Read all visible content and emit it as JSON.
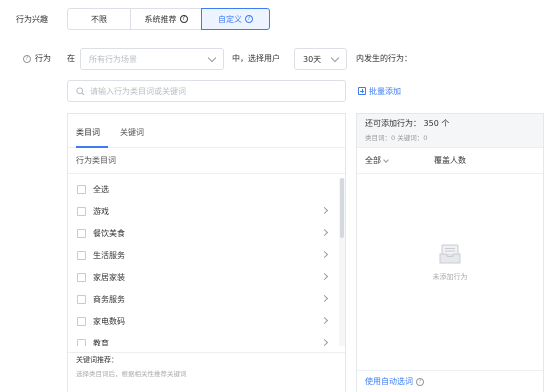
{
  "interest": {
    "label": "行为兴趣",
    "options": [
      "不限",
      "系统推荐",
      "自定义"
    ],
    "selected": "自定义"
  },
  "behavior": {
    "label": "行为",
    "prefix": "在",
    "scene_placeholder": "所有行为场景",
    "middle": "中，选择用户",
    "days_value": "30天",
    "suffix": "内发生的行为："
  },
  "search": {
    "placeholder": "请输入行为类目词或关键词"
  },
  "batch_add": "批量添加",
  "left_panel": {
    "tabs": [
      "类目词",
      "关键词"
    ],
    "active_tab": "类目词",
    "subheader": "行为类目词",
    "items": [
      "全选",
      "游戏",
      "餐饮美食",
      "生活服务",
      "家居家装",
      "商务服务",
      "家电数码",
      "教育"
    ],
    "keyword_rec_title": "关键词推荐：",
    "keyword_rec_hint": "选择类目词后，根据相关性推荐关键词"
  },
  "right_panel": {
    "capacity": "还可添加行为： 350 个",
    "counts": "类目词：0     关键词：0",
    "col_all": "全部",
    "col_cover": "覆盖人数",
    "empty": "未添加行为",
    "auto_select": "使用自动选词"
  },
  "colors": {
    "accent": "#3d7cf5",
    "border": "#dcdfe6"
  }
}
